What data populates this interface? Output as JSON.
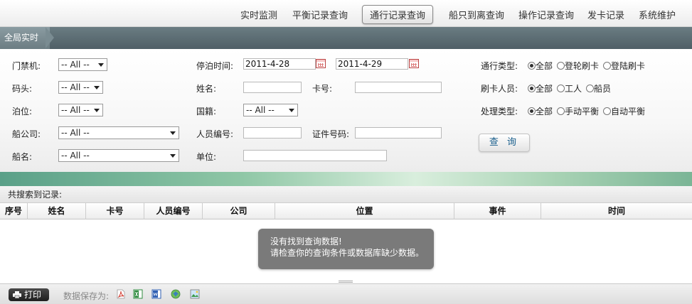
{
  "nav": {
    "items": [
      {
        "label": "实时监测"
      },
      {
        "label": "平衡记录查询"
      },
      {
        "label": "通行记录查询"
      },
      {
        "label": "船只到离查询"
      },
      {
        "label": "操作记录查询"
      },
      {
        "label": "发卡记录"
      },
      {
        "label": "系统维护"
      }
    ],
    "active_index": 2
  },
  "breadcrumb": {
    "current": "全局实时"
  },
  "form": {
    "gate": {
      "label": "门禁机:",
      "value": "-- All --"
    },
    "dock": {
      "label": "码头:",
      "value": "-- All --"
    },
    "berth": {
      "label": "泊位:",
      "value": "-- All --"
    },
    "ship_company": {
      "label": "船公司:",
      "value": "-- All --"
    },
    "ship_name": {
      "label": "船名:",
      "value": "-- All --"
    },
    "stay_time": {
      "label": "停泊时间:",
      "start": "2011-4-28",
      "end": "2011-4-29"
    },
    "name": {
      "label": "姓名:",
      "value": ""
    },
    "card_no": {
      "label": "卡号:",
      "value": ""
    },
    "nationality": {
      "label": "国籍:",
      "value": "-- All --"
    },
    "staff_no": {
      "label": "人员编号:",
      "value": ""
    },
    "id_no": {
      "label": "证件号码:",
      "value": ""
    },
    "unit": {
      "label": "单位:",
      "value": ""
    },
    "pass_type": {
      "label": "通行类型:",
      "options": [
        "全部",
        "登轮刷卡",
        "登陆刷卡"
      ],
      "selected": 0
    },
    "card_person": {
      "label": "刷卡人员:",
      "options": [
        "全部",
        "工人",
        "船员"
      ],
      "selected": 0
    },
    "process_type": {
      "label": "处理类型:",
      "options": [
        "全部",
        "手动平衡",
        "自动平衡"
      ],
      "selected": 0
    },
    "query_label": "查 询"
  },
  "results": {
    "summary": "共搜索到记录:",
    "columns": [
      "序号",
      "姓名",
      "卡号",
      "人员编号",
      "公司",
      "位置",
      "事件",
      "时间"
    ],
    "empty_line1": "没有找到查询数据!",
    "empty_line2": "请检查你的查询条件或数据库缺少数据。"
  },
  "footer": {
    "print_label": "打印",
    "save_as_label": "数据保存为:",
    "formats": [
      {
        "icon": "pdf-icon",
        "color": "#d03a2f"
      },
      {
        "icon": "excel-icon",
        "color": "#2e8b3e"
      },
      {
        "icon": "word-icon",
        "color": "#2f5fb3"
      },
      {
        "icon": "web-icon",
        "color": "#3a9c4a"
      },
      {
        "icon": "image-icon",
        "color": "#3b7fbf"
      }
    ]
  }
}
